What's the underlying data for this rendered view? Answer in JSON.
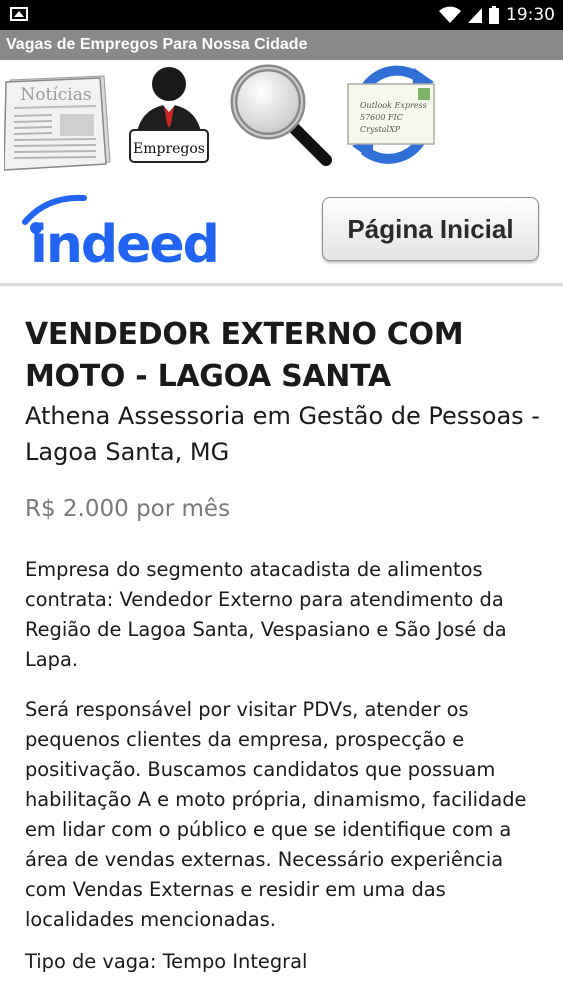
{
  "status_bar": {
    "time": "19:30",
    "icons": [
      "gallery-icon",
      "wifi-icon",
      "signal-icon",
      "battery-icon"
    ]
  },
  "app": {
    "title": "Vagas de Empregos Para Nossa Cidade"
  },
  "nav_icons": {
    "noticias_label": "Notícias",
    "empregos_label": "Empregos",
    "search": "search-icon",
    "email_lines": [
      "Outlook Express",
      "57600 FIC",
      "CrystalXP"
    ]
  },
  "brand": {
    "logo_text": "indeed",
    "home_button": "Página Inicial"
  },
  "job": {
    "title": "VENDEDOR EXTERNO COM MOTO - LAGOA SANTA",
    "company": "Athena Assessoria em Gestão de Pessoas - Lagoa Santa, MG",
    "salary": "R$ 2.000 por mês",
    "description_1": "Empresa do segmento atacadista de alimentos contrata: Vendedor Externo para atendimento da Região de Lagoa Santa, Vespasiano e São José da Lapa.",
    "description_2": "Será responsável por visitar PDVs, atender os pequenos clientes da empresa, prospecção e positivação. Buscamos candidatos que possuam habilitação A e moto própria, dinamismo, facilidade em lidar com o público e que se identifique com a área de vendas externas. Necessário experiência com Vendas Externas e residir em uma das localidades mencionadas.",
    "job_type": "Tipo de vaga: Tempo Integral"
  },
  "colors": {
    "titlebar": "#898989",
    "indeed_blue": "#2164f3",
    "salary_gray": "#7a7a7a"
  }
}
